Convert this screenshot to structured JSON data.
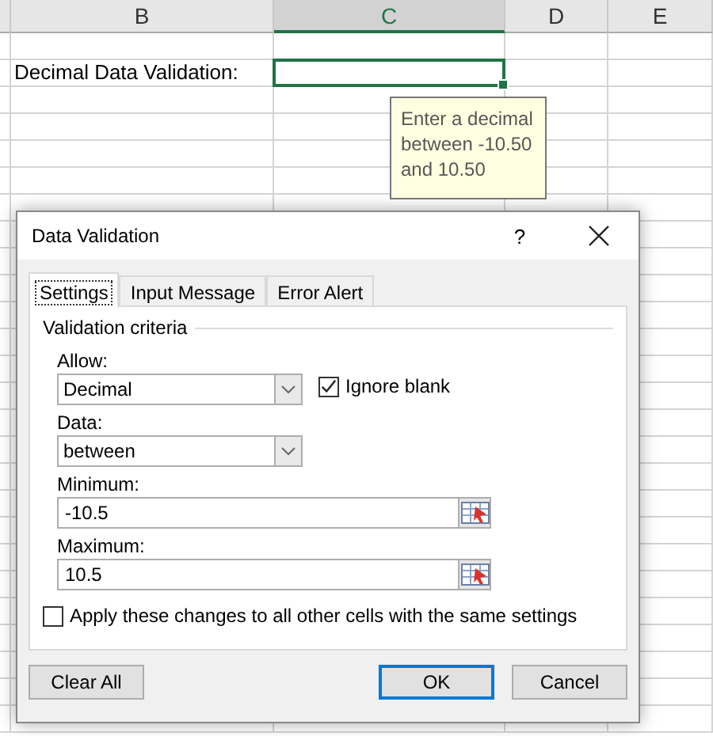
{
  "sheet": {
    "columns": [
      {
        "label": "B",
        "selected": false
      },
      {
        "label": "C",
        "selected": true
      },
      {
        "label": "D",
        "selected": false
      },
      {
        "label": "E",
        "selected": false
      }
    ],
    "cell_label": "Decimal Data Validation:",
    "input_tooltip": "Enter a decimal\nbetween -10.50\nand 10.50"
  },
  "dialog": {
    "title": "Data Validation",
    "help": "?",
    "tabs": [
      {
        "label": "Settings",
        "selected": true
      },
      {
        "label": "Input Message",
        "selected": false
      },
      {
        "label": "Error Alert",
        "selected": false
      }
    ],
    "group_title": "Validation criteria",
    "allow": {
      "label": "Allow:",
      "value": "Decimal"
    },
    "ignore_blank": {
      "label": "Ignore blank",
      "checked": true
    },
    "data": {
      "label": "Data:",
      "value": "between"
    },
    "minimum": {
      "label": "Minimum:",
      "value": "-10.5"
    },
    "maximum": {
      "label": "Maximum:",
      "value": "10.5"
    },
    "apply_all": {
      "label": "Apply these changes to all other cells with the same settings",
      "checked": false
    },
    "buttons": [
      {
        "label": "Clear All",
        "default": false,
        "kind": "left"
      },
      {
        "label": "OK",
        "default": true,
        "kind": "right"
      },
      {
        "label": "Cancel",
        "default": false,
        "kind": "right"
      }
    ]
  }
}
